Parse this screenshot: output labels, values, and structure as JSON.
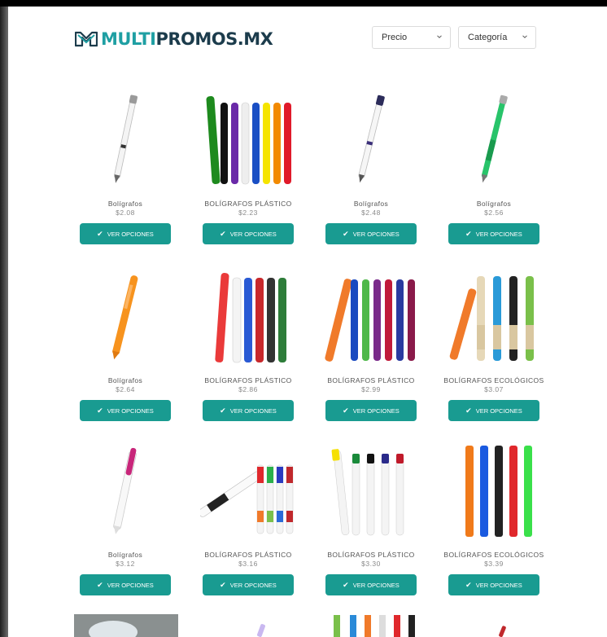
{
  "brand": {
    "part1": "MULTI",
    "part2": "PROMOS.MX"
  },
  "filters": {
    "price": "Precio",
    "category": "Categoría"
  },
  "button_label": "VER OPCIONES",
  "products": [
    {
      "name": "Bolígrafos",
      "price": "$2.08"
    },
    {
      "name": "BOLÍGRAFOS PLÁSTICO",
      "price": "$2.23"
    },
    {
      "name": "Bolígrafos",
      "price": "$2.48"
    },
    {
      "name": "Bolígrafos",
      "price": "$2.56"
    },
    {
      "name": "Bolígrafos",
      "price": "$2.64"
    },
    {
      "name": "BOLÍGRAFOS PLÁSTICO",
      "price": "$2.86"
    },
    {
      "name": "BOLÍGRAFOS PLÁSTICO",
      "price": "$2.99"
    },
    {
      "name": "BOLÍGRAFOS ECOLÓGICOS",
      "price": "$3.07"
    },
    {
      "name": "Bolígrafos",
      "price": "$3.12"
    },
    {
      "name": "BOLÍGRAFOS PLÁSTICO",
      "price": "$3.16"
    },
    {
      "name": "BOLÍGRAFOS PLÁSTICO",
      "price": "$3.30"
    },
    {
      "name": "BOLÍGRAFOS ECOLÓGICOS",
      "price": "$3.39"
    }
  ],
  "colors": {
    "accent": "#199b91",
    "logo_teal": "#1f9fa3",
    "logo_navy": "#1c3c4c"
  }
}
